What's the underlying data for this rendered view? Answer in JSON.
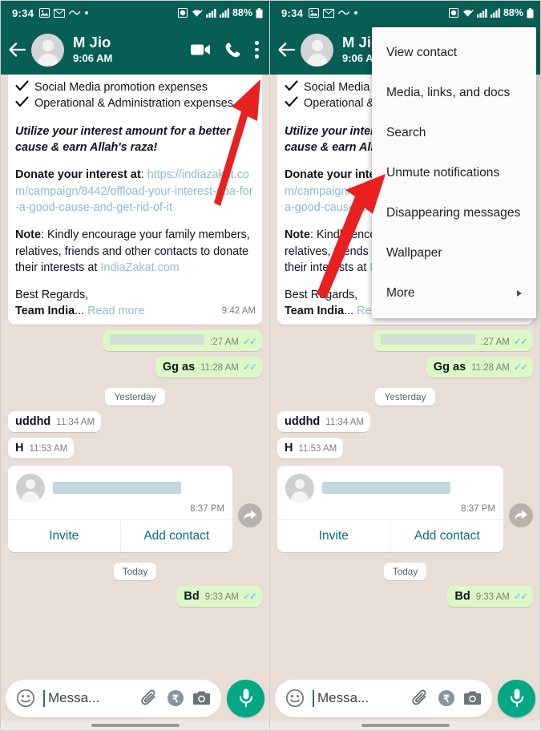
{
  "status_bar": {
    "time": "9:34",
    "battery": "88%",
    "icons": [
      "image-icon",
      "mail-icon",
      "wave-icon",
      "dot-icon",
      "alarm-icon",
      "wifi-icon",
      "signal-icon",
      "signal2-icon",
      "battery-icon"
    ]
  },
  "header": {
    "contact_name": "M Jio",
    "last_seen": "9:06 AM",
    "back_icon": "back-arrow-icon",
    "video_icon": "video-call-icon",
    "call_icon": "phone-call-icon",
    "menu_icon": "overflow-menu-icon"
  },
  "menu": {
    "items": [
      {
        "label": "View contact",
        "has_submenu": false
      },
      {
        "label": "Media, links, and docs",
        "has_submenu": false
      },
      {
        "label": "Search",
        "has_submenu": false
      },
      {
        "label": "Unmute notifications",
        "has_submenu": false
      },
      {
        "label": "Disappearing messages",
        "has_submenu": false
      },
      {
        "label": "Wallpaper",
        "has_submenu": false
      },
      {
        "label": "More",
        "has_submenu": true
      }
    ]
  },
  "promo_message": {
    "bullets": [
      "Social Media promotion expenses",
      "Operational & Administration expenses"
    ],
    "highlight": "Utilize your interest amount for a better cause & earn Allah's raza!",
    "donate_label": "Donate your interest at",
    "donate_url": "https://indiazakat.com/campaign/8442/offload-your-interest-riba-for-a-good-cause-and-get-rid-of-it",
    "note_label": "Note",
    "note_text": ": Kindly encourage your family members, relatives, friends and other contacts to donate their interests at ",
    "note_link": "IndiaZakat.com",
    "signoff_line1": "Best Regards,",
    "signoff_line2": "Team India",
    "ellipsis": "...",
    "read_more": "Read more",
    "time": "9:42 AM"
  },
  "messages": [
    {
      "type": "out",
      "text": "",
      "redacted": true,
      "time": ":27 AM",
      "ticks": "✓✓"
    },
    {
      "type": "out",
      "text": "Gg as",
      "redacted": false,
      "time": "11:28 AM",
      "ticks": "✓✓"
    },
    {
      "type": "divider",
      "text": "Yesterday"
    },
    {
      "type": "in",
      "text": "uddhd",
      "redacted": false,
      "time": "11:34 AM",
      "ticks": ""
    },
    {
      "type": "in",
      "text": "H",
      "redacted": false,
      "time": "11:53 AM",
      "ticks": ""
    }
  ],
  "contact_card": {
    "name_redacted": true,
    "time": "8:37 PM",
    "invite_label": "Invite",
    "add_contact_label": "Add contact",
    "forward_icon": "forward-arrow-icon"
  },
  "today_divider": "Today",
  "last_message": {
    "text": "Bd",
    "time": "9:33 AM",
    "ticks": "✓✓"
  },
  "input_bar": {
    "placeholder": "Messa...",
    "emoji_icon": "emoji-smiley-icon",
    "attach_icon": "paperclip-icon",
    "payment_icon": "rupee-payment-icon",
    "camera_icon": "camera-icon",
    "mic_icon": "microphone-icon"
  },
  "annotations": {
    "arrow_color": "#e8201f",
    "left_arrow_target": "overflow-menu-icon",
    "right_arrow_target": "Unmute notifications"
  }
}
